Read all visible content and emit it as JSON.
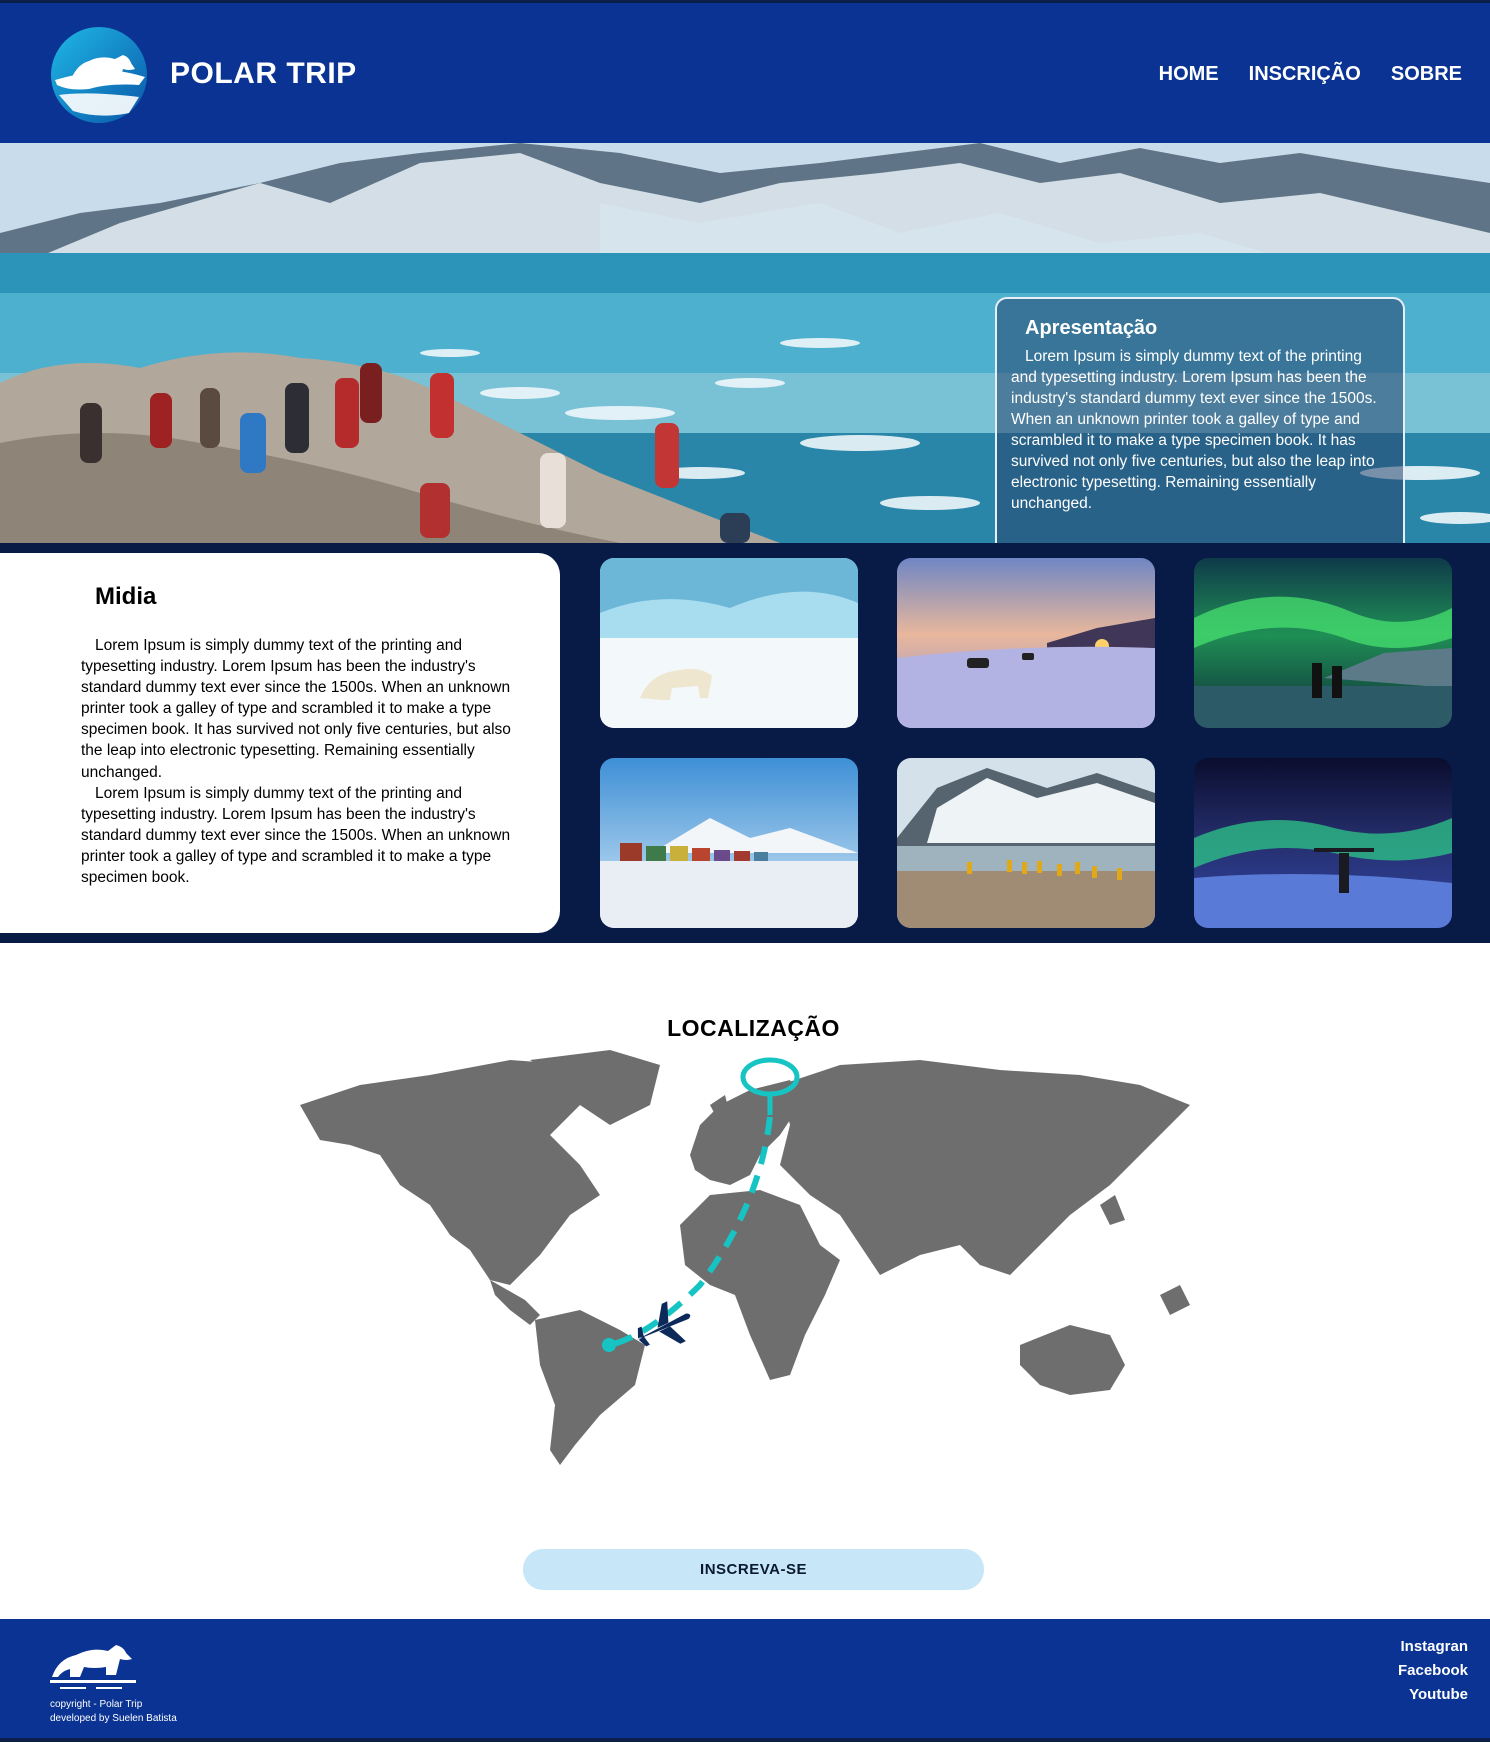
{
  "header": {
    "brand": "POLAR TRIP",
    "nav": [
      "HOME",
      "INSCRIÇÃO",
      "SOBRE"
    ]
  },
  "hero": {
    "card_title": "Apresentação",
    "card_text": "Lorem Ipsum is simply dummy text of the printing and typesetting industry. Lorem Ipsum has been the industry's standard dummy text ever since the 1500s. When an unknown printer took a galley of type and scrambled it to make a type specimen book. It has survived not only five centuries, but also the leap into electronic typesetting. Remaining essentially unchanged."
  },
  "media": {
    "title": "Midia",
    "paragraphs": [
      "Lorem Ipsum is simply dummy text of the printing and typesetting industry. Lorem Ipsum has been the industry's standard dummy text ever since the 1500s. When an unknown printer took a galley of type and scrambled it to make a type specimen book. It has survived not only five centuries, but also the leap into electronic typesetting. Remaining essentially unchanged.",
      "Lorem Ipsum is simply dummy text of the printing and typesetting industry. Lorem Ipsum has been the industry's standard dummy text ever since the 1500s. When an unknown printer took a galley of type and scrambled it to make a type specimen book."
    ]
  },
  "location": {
    "title": "LOCALIZAÇÃO",
    "button": "INSCREVA-SE"
  },
  "footer": {
    "copyright": "copyright - Polar Trip",
    "developer": "developed by Suelen Batista",
    "social": [
      "Instagran",
      "Facebook",
      "Youtube"
    ]
  },
  "colors": {
    "header_bg": "#0a3393",
    "media_bg": "#071b46",
    "route": "#17c4c4",
    "button_bg": "#c7e6f8"
  }
}
